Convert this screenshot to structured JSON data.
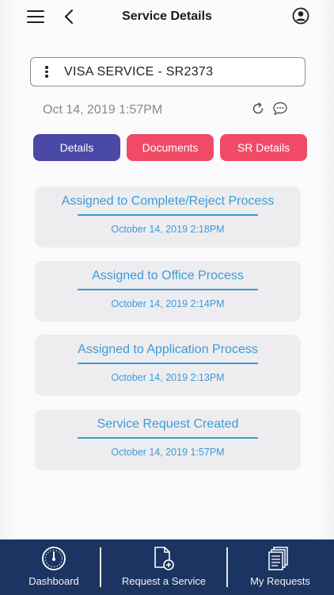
{
  "header": {
    "title": "Service Details"
  },
  "service": {
    "label": "VISA SERVICE - SR2373"
  },
  "meta": {
    "date": "Oct 14, 2019 1:57PM"
  },
  "tabs": [
    {
      "label": "Details",
      "active": true
    },
    {
      "label": "Documents",
      "active": false
    },
    {
      "label": "SR Details",
      "active": false
    }
  ],
  "timeline": [
    {
      "title": "Assigned to Complete/Reject Process",
      "date": "October 14, 2019 2:18PM"
    },
    {
      "title": "Assigned to Office Process",
      "date": "October 14, 2019 2:14PM"
    },
    {
      "title": "Assigned to Application Process",
      "date": "October 14, 2019 2:13PM"
    },
    {
      "title": "Service Request Created",
      "date": "October 14, 2019 1:57PM"
    }
  ],
  "bottom_nav": [
    {
      "label": "Dashboard",
      "icon": "dashboard-gauge-icon"
    },
    {
      "label": "Request a Service",
      "icon": "document-add-icon"
    },
    {
      "label": "My Requests",
      "icon": "documents-stack-icon"
    }
  ],
  "colors": {
    "primary_tab": "#4a49a6",
    "secondary_tab": "#f04a67",
    "link_blue": "#3d9bd6",
    "nav_bg": "#1c3461"
  }
}
